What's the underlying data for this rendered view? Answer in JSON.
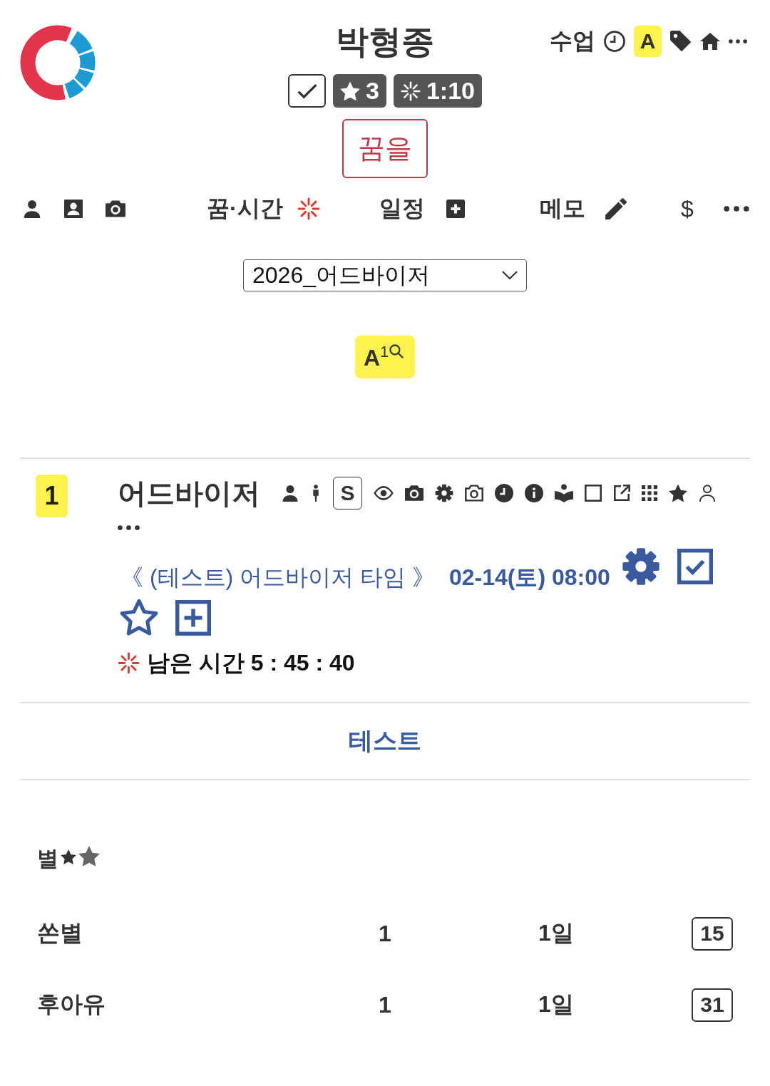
{
  "header": {
    "title": "박형종",
    "checkbox": {
      "checked": true
    },
    "star_count": "3",
    "timer": "1:10",
    "action_button": "꿈을",
    "menu_label": "수업",
    "grade": "A"
  },
  "nav": {
    "links": [
      "꿈·시간",
      "일정",
      "메모"
    ],
    "currency": "$"
  },
  "select": {
    "value": "2026_어드바이저"
  },
  "filter_badge": "A$^{1}$",
  "items": [
    {
      "number": "1",
      "title": "어드바이저",
      "s_badge": "S",
      "event": {
        "title": "《 (테스트) 어드바이저 타임 》",
        "datetime": "02-14(토) 08:00",
        "checked": true,
        "starred": false
      },
      "remaining": "남은 시간 5 : 45 : 40"
    }
  ],
  "section_title": "테스트",
  "stars": {
    "title": "별",
    "rows": [
      {
        "name": "쏜별",
        "count": "1",
        "duration": "1일",
        "day": "15"
      },
      {
        "name": "후아유",
        "count": "1",
        "duration": "1일",
        "day": "31"
      }
    ]
  }
}
